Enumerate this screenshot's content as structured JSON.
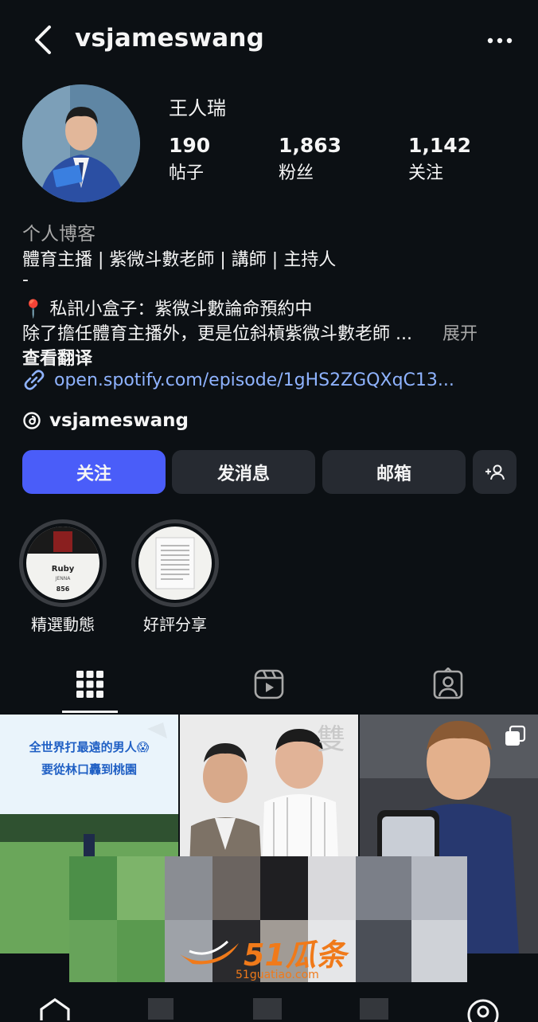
{
  "header": {
    "username": "vsjameswang"
  },
  "profile": {
    "display_name": "王人瑞",
    "stats": [
      {
        "value": "190",
        "label": "帖子"
      },
      {
        "value": "1,863",
        "label": "粉丝"
      },
      {
        "value": "1,142",
        "label": "关注"
      }
    ],
    "category": "个人博客",
    "bio_lines": [
      "體育主播 | 紫微斗數老師 | 講師 | 主持人",
      "-",
      "📍 私訊小盒子：紫微斗數論命預約中",
      "除了擔任體育主播外，更是位斜槓紫微斗數老師 ..."
    ],
    "expand_label": "展开",
    "translate_label": "查看翻译",
    "link": "open.spotify.com/episode/1gHS2ZGQXqC13...",
    "threads_handle": "vsjameswang"
  },
  "actions": {
    "follow": "关注",
    "message": "发消息",
    "email": "邮箱",
    "add_user_icon": "add-user-icon"
  },
  "highlights": [
    {
      "label": "精選動態",
      "cover_text": [
        "Ruby",
        "JENNA",
        "856"
      ]
    },
    {
      "label": "好評分享"
    }
  ],
  "tabs": [
    "grid-icon",
    "reels-icon",
    "tagged-icon"
  ],
  "grid_posts": [
    {
      "caption_line1": "全世界打最遠的男人😱",
      "caption_line2": "要從林口轟到桃園"
    },
    {
      "caption": "雙"
    },
    {
      "type": "carousel"
    }
  ],
  "watermark": {
    "text": "51瓜条",
    "url": "51guatiao.com"
  },
  "colors": {
    "background": "#0c1014",
    "accent": "#4a5df9",
    "link": "#8fb3ff",
    "button": "#262a31"
  }
}
